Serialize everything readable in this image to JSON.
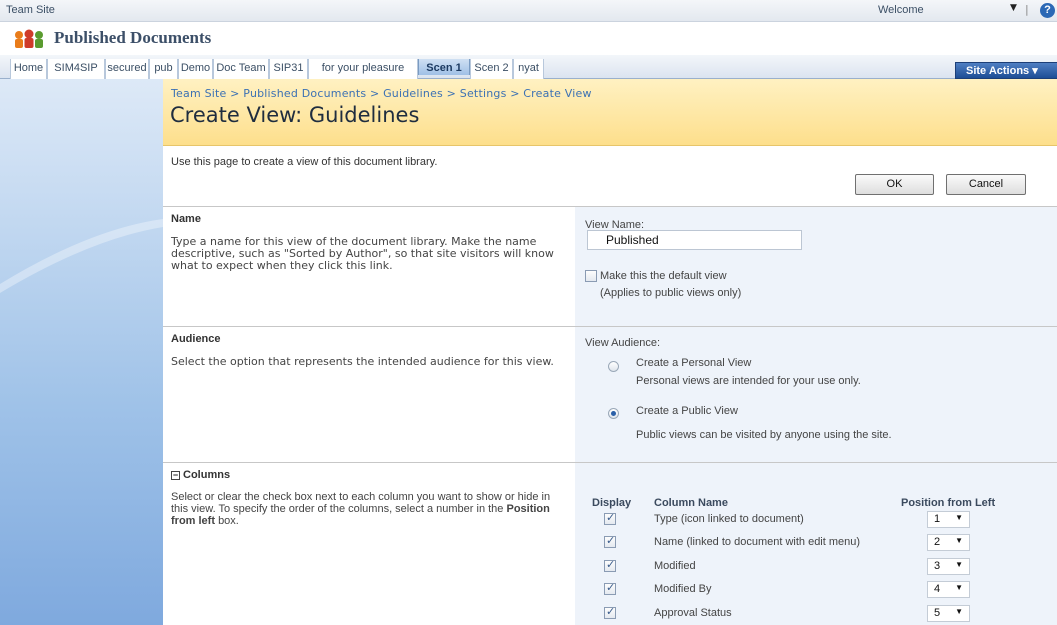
{
  "topbar": {
    "site": "Team Site",
    "welcome": "Welcome",
    "caret": "▼",
    "sep": "|",
    "help": "?"
  },
  "brand": {
    "title": "Published Documents"
  },
  "tabs": [
    "Home",
    "SIM4SIP",
    "secured",
    "pub",
    "Demo",
    "Doc Team",
    "SIP31",
    "for your pleasure",
    "Scen 1",
    "Scen 2",
    "nyat"
  ],
  "selected_tab": "Scen 1",
  "site_actions": "Site Actions ▾",
  "header": {
    "breadcrumb": "Team Site > Published Documents > Guidelines > Settings > Create View",
    "title": "Create View: Guidelines"
  },
  "intro": "Use this page to create a view of this document library.",
  "buttons": {
    "ok": "OK",
    "cancel": "Cancel"
  },
  "name_section": {
    "title": "Name",
    "desc": "Type a name for this view of the document library. Make the name descriptive, such as \"Sorted by Author\", so that site visitors will know what to expect when they click this link.",
    "view_name_label": "View Name:",
    "view_name_value": "Published",
    "default_label": "Make this the default view",
    "default_note": "(Applies to public views only)"
  },
  "audience_section": {
    "title": "Audience",
    "desc": "Select the option that represents the intended audience for this view.",
    "label": "View Audience:",
    "personal_label": "Create a Personal View",
    "personal_desc": "Personal views are intended for your use only.",
    "public_label": "Create a Public View",
    "public_desc": "Public views can be visited by anyone using the site."
  },
  "columns_section": {
    "title": "Columns",
    "toggle": "−",
    "desc_1": "Select or clear the check box next to each column you want to show or hide in this view. To specify the order of the columns, select a number in the",
    "desc_bold": "Position from left",
    "desc_2": "box.",
    "head_display": "Display",
    "head_name": "Column Name",
    "head_position": "Position from Left",
    "rows": [
      {
        "name": "Type (icon linked to document)",
        "position": "1"
      },
      {
        "name": "Name (linked to document with edit menu)",
        "position": "2"
      },
      {
        "name": "Modified",
        "position": "3"
      },
      {
        "name": "Modified By",
        "position": "4"
      },
      {
        "name": "Approval Status",
        "position": "5"
      }
    ]
  }
}
